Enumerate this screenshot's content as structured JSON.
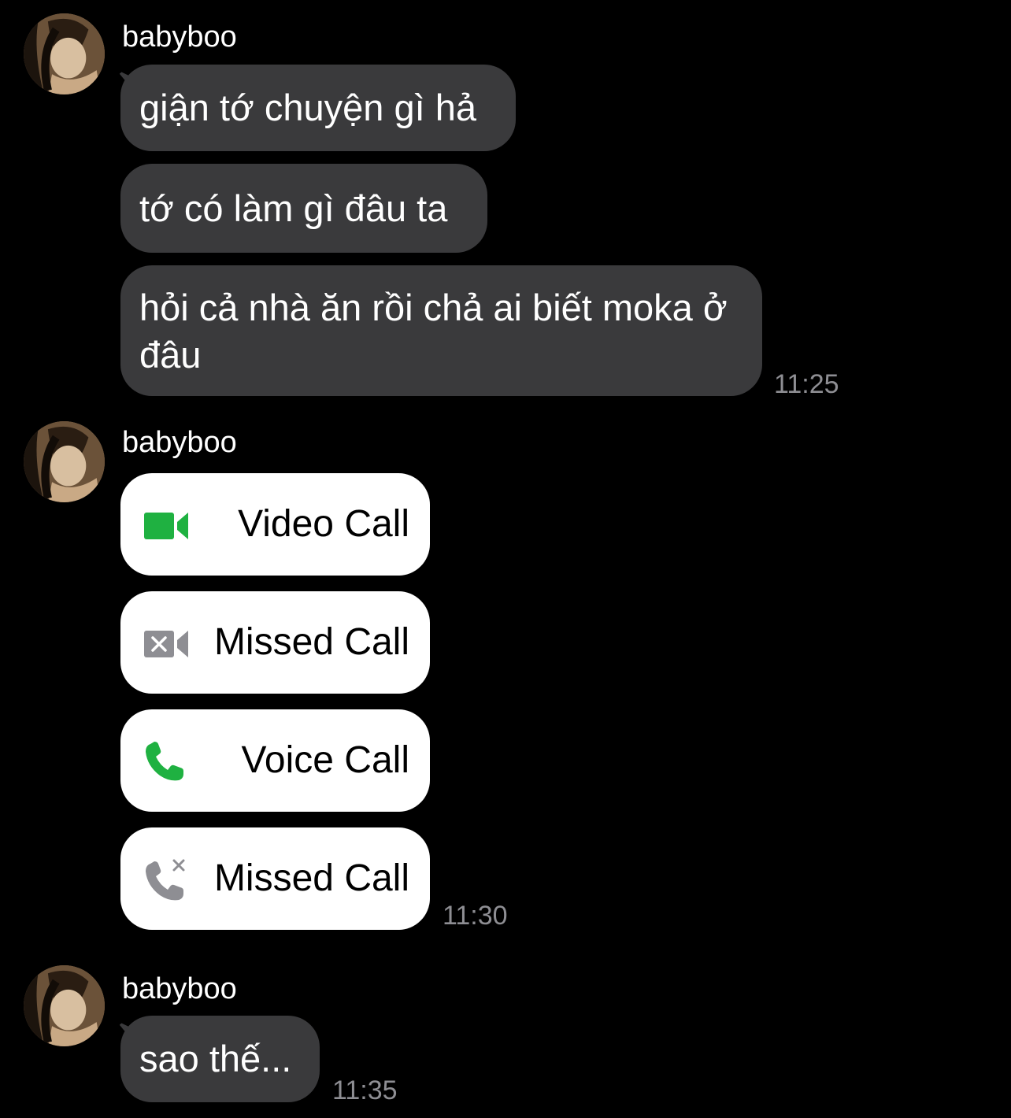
{
  "groups": [
    {
      "sender": "babyboo",
      "messages": [
        "giận tớ chuyện gì hả",
        "tớ có làm gì đâu ta",
        "hỏi cả nhà ăn rồi chả ai biết moka ở đâu"
      ],
      "time": "11:25"
    },
    {
      "sender": "babyboo",
      "calls": [
        {
          "label": "Video Call",
          "icon": "video-camera-icon",
          "color": "#1fb141"
        },
        {
          "label": "Missed Call",
          "icon": "missed-video-icon",
          "color": "#8e8e93"
        },
        {
          "label": "Voice Call",
          "icon": "phone-icon",
          "color": "#1fb141"
        },
        {
          "label": "Missed Call",
          "icon": "missed-phone-icon",
          "color": "#8e8e93"
        }
      ],
      "time": "11:30"
    },
    {
      "sender": "babyboo",
      "messages": [
        "sao thế..."
      ],
      "time": "11:35"
    }
  ],
  "colors": {
    "background": "#000000",
    "bubble": "#3a3a3c",
    "call_bubble": "#ffffff",
    "call_green": "#1fb141",
    "missed_gray": "#8e8e93",
    "timestamp": "#8e8e93"
  }
}
